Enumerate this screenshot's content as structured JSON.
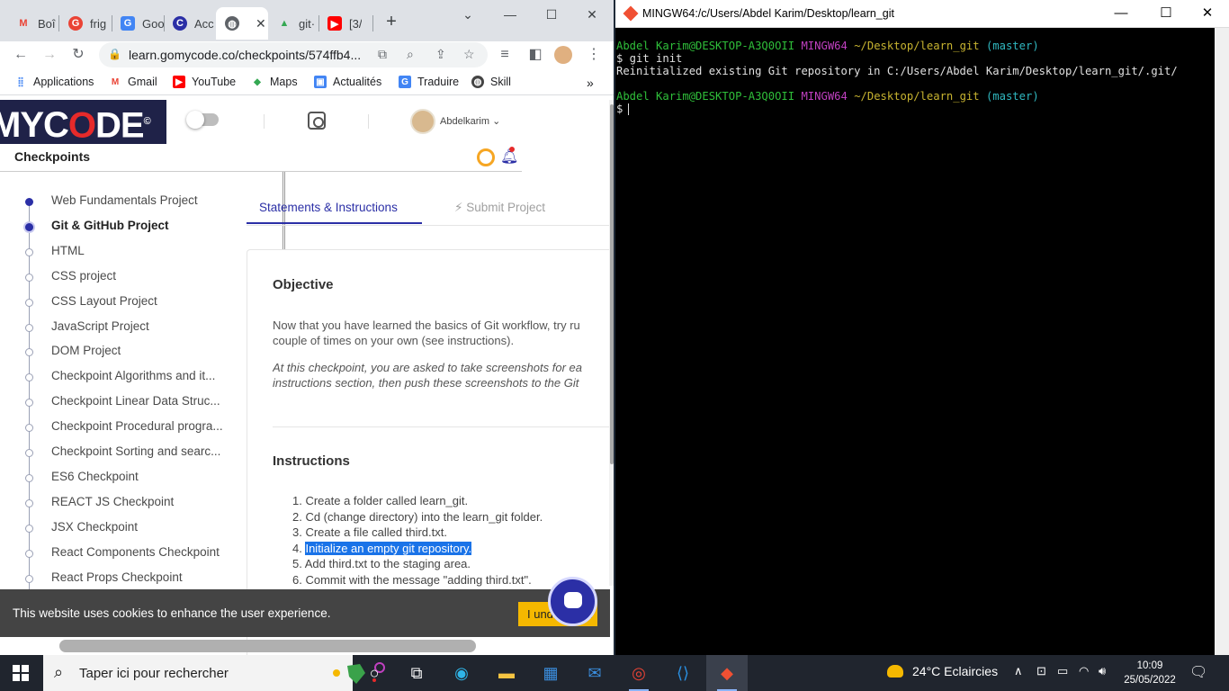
{
  "chrome": {
    "tabs": [
      {
        "title": "Boî",
        "icon": "gmail-icon"
      },
      {
        "title": "frig",
        "icon": "google-icon"
      },
      {
        "title": "Goo",
        "icon": "translate-icon"
      },
      {
        "title": "Acc",
        "icon": "gomycode-icon"
      },
      {
        "title": "",
        "icon": "globe-icon"
      },
      {
        "title": "git·",
        "icon": "drive-icon"
      },
      {
        "title": "[3/",
        "icon": "youtube-icon"
      }
    ],
    "url": "learn.gomycode.co/checkpoints/574ffb4...",
    "bookmarks": [
      "Applications",
      "Gmail",
      "YouTube",
      "Maps",
      "Actualités",
      "Traduire",
      "Skill"
    ]
  },
  "page": {
    "logo_text": "MYCODE",
    "username": "Abdelkarim",
    "section_title": "Checkpoints",
    "sidebar_items": [
      "Web Fundamentals Project",
      "Git & GitHub Project",
      "HTML",
      "CSS project",
      "CSS Layout Project",
      "JavaScript Project",
      "DOM Project",
      "Checkpoint Algorithms and it...",
      "Checkpoint Linear Data Struc...",
      "Checkpoint Procedural progra...",
      "Checkpoint Sorting and searc...",
      "ES6 Checkpoint",
      "REACT JS Checkpoint",
      "JSX Checkpoint",
      "React Components Checkpoint",
      "React Props Checkpoint"
    ],
    "tabs": {
      "statements": "Statements & Instructions",
      "submit": "Submit Project"
    },
    "objective": {
      "title": "Objective",
      "p1_line1": "Now that you have learned the basics of Git workflow, try ru",
      "p1_line2": "couple of times on your own (see instructions).",
      "p2_line1": "At this checkpoint, you are asked to take screenshots for ea",
      "p2_line2": "instructions section, then push these screenshots to the Git"
    },
    "instructions": {
      "title": "Instructions",
      "items": [
        "1. Create a folder called learn_git.",
        "2. Cd (change directory) into the learn_git folder.",
        "3. Create a file called third.txt.",
        "Initialize an empty git repository.",
        "5. Add third.txt to the staging area.",
        "6. Commit with the message \"adding third.txt\"."
      ],
      "item4_number": "4. "
    },
    "cookie": {
      "text": "This website uses cookies to enhance the user experience.",
      "button": "I understand"
    }
  },
  "terminal": {
    "title": "MINGW64:/c/Users/Abdel Karim/Desktop/learn_git",
    "prompt_user": "Abdel Karim@DESKTOP-A3Q0OII",
    "prompt_env": "MINGW64",
    "prompt_path": "~/Desktop/learn_git",
    "prompt_branch": "(master)",
    "command": "$ git init",
    "output": "Reinitialized existing Git repository in C:/Users/Abdel Karim/Desktop/learn_git/.git/",
    "prompt_symbol": "$"
  },
  "taskbar": {
    "search_placeholder": "Taper ici pour rechercher",
    "weather": "24°C  Eclaircies",
    "time": "10:09",
    "date": "25/05/2022"
  }
}
